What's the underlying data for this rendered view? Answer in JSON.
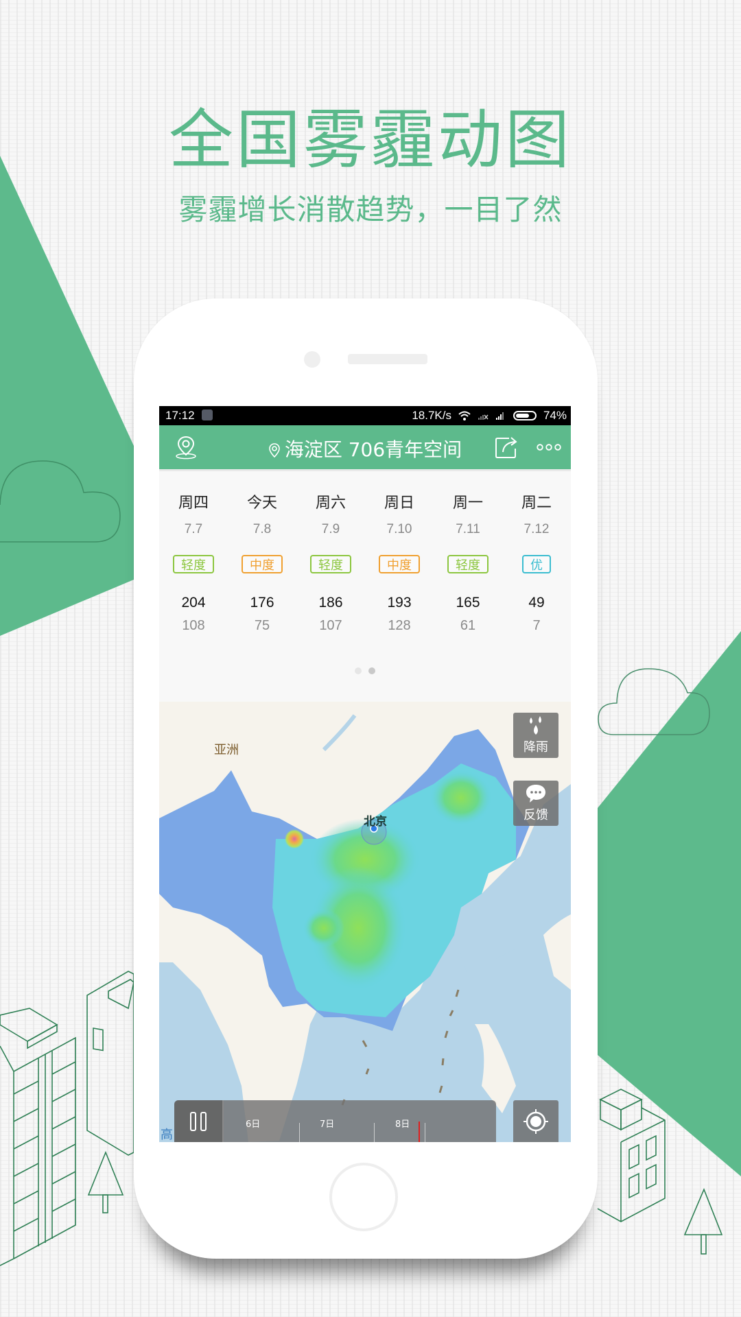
{
  "promo": {
    "headline": "全国雾霾动图",
    "subheadline": "雾霾增长消散趋势，一目了然",
    "accent_color": "#5bb98b"
  },
  "status_bar": {
    "time": "17:12",
    "network_speed": "18.7K/s",
    "battery_percent": "74%",
    "battery_level": 0.74
  },
  "app_bar": {
    "location_title": "海淀区 706青年空间",
    "left_icon": "location-pin-icon",
    "share_icon": "share-icon",
    "more_icon": "more-icon",
    "background_color": "#5dba8c"
  },
  "forecast": {
    "days": [
      {
        "name": "周四",
        "date": "7.7",
        "level": "轻度",
        "level_color": "#8cc63f",
        "aqi_high": "204",
        "aqi_low": "108"
      },
      {
        "name": "今天",
        "date": "7.8",
        "level": "中度",
        "level_color": "#f0a030",
        "aqi_high": "176",
        "aqi_low": "75"
      },
      {
        "name": "周六",
        "date": "7.9",
        "level": "轻度",
        "level_color": "#8cc63f",
        "aqi_high": "186",
        "aqi_low": "107"
      },
      {
        "name": "周日",
        "date": "7.10",
        "level": "中度",
        "level_color": "#f0a030",
        "aqi_high": "193",
        "aqi_low": "128"
      },
      {
        "name": "周一",
        "date": "7.11",
        "level": "轻度",
        "level_color": "#8cc63f",
        "aqi_high": "165",
        "aqi_low": "61"
      },
      {
        "name": "周二",
        "date": "7.12",
        "level": "优",
        "level_color": "#3bbdd0",
        "aqi_high": "49",
        "aqi_low": "7"
      }
    ],
    "page_count": 2,
    "active_page": 2
  },
  "map": {
    "region_label": "亚洲",
    "city_label": "北京",
    "rain_button_label": "降雨",
    "feedback_button_label": "反馈",
    "timeline": {
      "labels": [
        "6日",
        "7日",
        "8日"
      ],
      "play_state": "paused"
    },
    "locate_button": "locate-icon",
    "map_credit_fragment": "高"
  }
}
